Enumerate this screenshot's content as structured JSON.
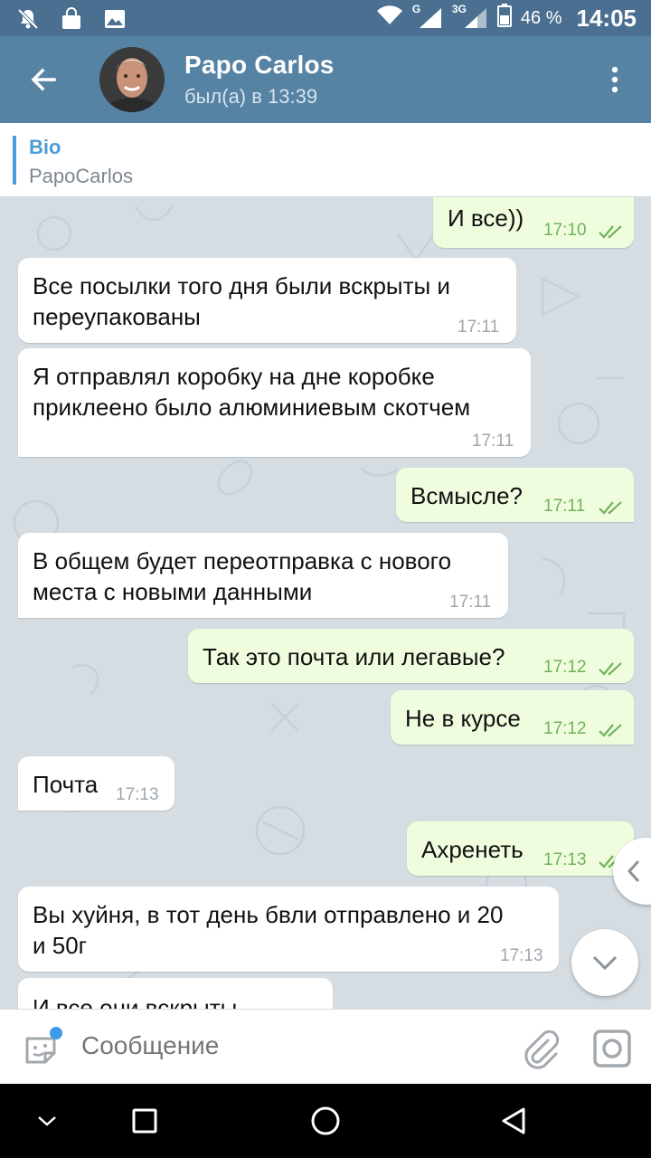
{
  "status_bar": {
    "icons": [
      "mute-icon",
      "shopping-bag-icon",
      "image-icon",
      "wifi-icon",
      "signal-icon",
      "battery-icon"
    ],
    "signal1_label": "G",
    "signal2_label": "3G",
    "battery_percent": "46 %",
    "time": "14:05"
  },
  "header": {
    "name": "Papo Carlos",
    "status": "был(а) в 13:39",
    "color": "#5682a3"
  },
  "bio": {
    "title": "Bio",
    "value": "PapoCarlos"
  },
  "messages": [
    {
      "dir": "out",
      "text": "И все))",
      "time": "17:10",
      "read": true
    },
    {
      "dir": "in",
      "text": "Все посылки того дня были вскрыты и\nпереупакованы",
      "time": "17:11"
    },
    {
      "dir": "in",
      "text": "Я отправлял коробку на дне коробке\nприклеено было алюминиевым скотчем",
      "time": "17:11"
    },
    {
      "dir": "out",
      "text": "Всмысле?",
      "time": "17:11",
      "read": true
    },
    {
      "dir": "in",
      "text": "В общем будет переотправка с нового\nместа с новыми данными",
      "time": "17:11"
    },
    {
      "dir": "out",
      "text": "Так это почта или легавые?",
      "time": "17:12",
      "read": true
    },
    {
      "dir": "out",
      "text": "Не в курсе",
      "time": "17:12",
      "read": true
    },
    {
      "dir": "in",
      "text": "Почта",
      "time": "17:13"
    },
    {
      "dir": "out",
      "text": "Ахренеть",
      "time": "17:13",
      "read": true
    },
    {
      "dir": "in",
      "text": "Вы хуйня, в тот день бвли отправлено и 20\nи 50г",
      "time": "17:13"
    },
    {
      "dir": "in",
      "text": "И все они вскрыты",
      "time": ""
    }
  ],
  "input": {
    "placeholder": "Сообщение"
  },
  "colors": {
    "incoming_bubble": "#ffffff",
    "outgoing_bubble": "#effdde",
    "read_ticks": "#6fb25a",
    "chat_background": "#d5dde3"
  }
}
